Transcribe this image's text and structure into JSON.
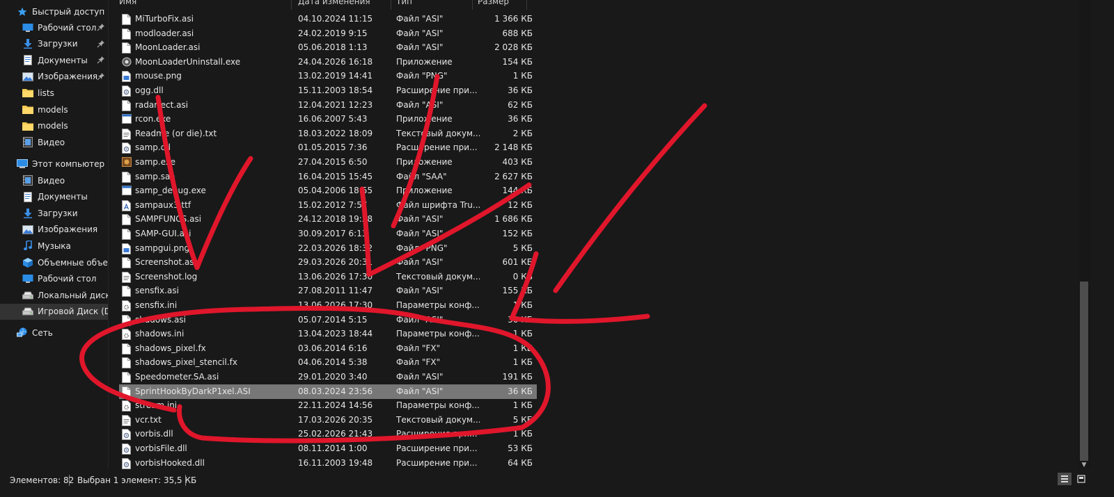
{
  "sidebar": {
    "quick_access": {
      "label": "Быстрый доступ",
      "icon": "star-icon"
    },
    "quick_items": [
      {
        "label": "Рабочий стол",
        "icon": "desktop-icon",
        "pinned": true
      },
      {
        "label": "Загрузки",
        "icon": "download-icon",
        "pinned": true
      },
      {
        "label": "Документы",
        "icon": "documents-icon",
        "pinned": true
      },
      {
        "label": "Изображения",
        "icon": "pictures-icon",
        "pinned": true
      },
      {
        "label": "lists",
        "icon": "folder-icon",
        "pinned": false
      },
      {
        "label": "models",
        "icon": "folder-icon",
        "pinned": false
      },
      {
        "label": "models",
        "icon": "folder-icon",
        "pinned": false
      },
      {
        "label": "Видео",
        "icon": "video-icon",
        "pinned": false
      }
    ],
    "this_pc": {
      "label": "Этот компьютер",
      "icon": "computer-icon"
    },
    "pc_items": [
      {
        "label": "Видео",
        "icon": "video-icon"
      },
      {
        "label": "Документы",
        "icon": "documents-icon"
      },
      {
        "label": "Загрузки",
        "icon": "download-icon"
      },
      {
        "label": "Изображения",
        "icon": "pictures-icon"
      },
      {
        "label": "Музыка",
        "icon": "music-icon"
      },
      {
        "label": "Объемные объекты",
        "icon": "3d-objects-icon"
      },
      {
        "label": "Рабочий стол",
        "icon": "desktop-icon"
      },
      {
        "label": "Локальный диск (C:)",
        "icon": "drive-icon"
      },
      {
        "label": "Игровой Диск (D:)",
        "icon": "drive-icon",
        "selected": true
      }
    ],
    "network": {
      "label": "Сеть",
      "icon": "network-icon"
    }
  },
  "columns": {
    "name": "Имя",
    "date": "Дата изменения",
    "type": "Тип",
    "size": "Размер"
  },
  "files": [
    {
      "name": "MiTurboFix.asi",
      "date": "04.10.2024 11:15",
      "type": "Файл \"ASI\"",
      "size": "1 366 КБ",
      "icon": "file-icon"
    },
    {
      "name": "modloader.asi",
      "date": "24.02.2019 9:15",
      "type": "Файл \"ASI\"",
      "size": "688 КБ",
      "icon": "file-icon"
    },
    {
      "name": "MoonLoader.asi",
      "date": "05.06.2018 1:13",
      "type": "Файл \"ASI\"",
      "size": "2 028 КБ",
      "icon": "file-icon"
    },
    {
      "name": "MoonLoaderUninstall.exe",
      "date": "24.04.2026 16:18",
      "type": "Приложение",
      "size": "154 КБ",
      "icon": "installer-icon"
    },
    {
      "name": "mouse.png",
      "date": "13.02.2019 14:41",
      "type": "Файл \"PNG\"",
      "size": "1 КБ",
      "icon": "image-file-icon"
    },
    {
      "name": "ogg.dll",
      "date": "15.11.2003 18:54",
      "type": "Расширение при...",
      "size": "36 КБ",
      "icon": "dll-icon"
    },
    {
      "name": "radarrect.asi",
      "date": "12.04.2021 12:23",
      "type": "Файл \"ASI\"",
      "size": "62 КБ",
      "icon": "file-icon"
    },
    {
      "name": "rcon.exe",
      "date": "16.06.2007 5:43",
      "type": "Приложение",
      "size": "36 КБ",
      "icon": "exe-icon"
    },
    {
      "name": "Readme (or die).txt",
      "date": "18.03.2022 18:09",
      "type": "Текстовый докум...",
      "size": "2 КБ",
      "icon": "text-file-icon"
    },
    {
      "name": "samp.dll",
      "date": "01.05.2015 7:36",
      "type": "Расширение при...",
      "size": "2 148 КБ",
      "icon": "dll-icon"
    },
    {
      "name": "samp.exe",
      "date": "27.04.2015 6:50",
      "type": "Приложение",
      "size": "403 КБ",
      "icon": "samp-app-icon"
    },
    {
      "name": "samp.saa",
      "date": "16.04.2015 15:45",
      "type": "Файл \"SAA\"",
      "size": "2 627 КБ",
      "icon": "file-icon"
    },
    {
      "name": "samp_debug.exe",
      "date": "05.04.2006 18:55",
      "type": "Приложение",
      "size": "144 КБ",
      "icon": "exe-icon"
    },
    {
      "name": "sampaux3.ttf",
      "date": "15.02.2012 7:57",
      "type": "Файл шрифта Tru...",
      "size": "12 КБ",
      "icon": "font-file-icon"
    },
    {
      "name": "SAMPFUNCS.asi",
      "date": "24.12.2018 19:28",
      "type": "Файл \"ASI\"",
      "size": "1 686 КБ",
      "icon": "file-icon"
    },
    {
      "name": "SAMP-GUI.asi",
      "date": "30.09.2017 6:13",
      "type": "Файл \"ASI\"",
      "size": "152 КБ",
      "icon": "file-icon"
    },
    {
      "name": "sampgui.png",
      "date": "22.03.2026 18:32",
      "type": "Файл \"PNG\"",
      "size": "5 КБ",
      "icon": "image-file-icon"
    },
    {
      "name": "Screenshot.asi",
      "date": "29.03.2026 20:31",
      "type": "Файл \"ASI\"",
      "size": "601 КБ",
      "icon": "file-icon"
    },
    {
      "name": "Screenshot.log",
      "date": "13.06.2026 17:30",
      "type": "Текстовый докум...",
      "size": "0 КБ",
      "icon": "text-file-icon"
    },
    {
      "name": "sensfix.asi",
      "date": "27.08.2011 11:47",
      "type": "Файл \"ASI\"",
      "size": "155 КБ",
      "icon": "file-icon"
    },
    {
      "name": "sensfix.ini",
      "date": "13.06.2026 17:30",
      "type": "Параметры конф...",
      "size": "1 КБ",
      "icon": "settings-file-icon"
    },
    {
      "name": "shadows.asi",
      "date": "05.07.2014 5:15",
      "type": "Файл \"ASI\"",
      "size": "36 КБ",
      "icon": "file-icon"
    },
    {
      "name": "shadows.ini",
      "date": "13.04.2023 18:44",
      "type": "Параметры конф...",
      "size": "1 КБ",
      "icon": "settings-file-icon"
    },
    {
      "name": "shadows_pixel.fx",
      "date": "03.06.2014 6:16",
      "type": "Файл \"FX\"",
      "size": "1 КБ",
      "icon": "file-icon"
    },
    {
      "name": "shadows_pixel_stencil.fx",
      "date": "04.06.2014 5:38",
      "type": "Файл \"FX\"",
      "size": "1 КБ",
      "icon": "file-icon"
    },
    {
      "name": "Speedometer.SA.asi",
      "date": "29.01.2020 3:40",
      "type": "Файл \"ASI\"",
      "size": "191 КБ",
      "icon": "file-icon"
    },
    {
      "name": "SprintHookByDarkP1xel.ASI",
      "date": "08.03.2024 23:56",
      "type": "Файл \"ASI\"",
      "size": "36 КБ",
      "icon": "file-icon",
      "selected": true
    },
    {
      "name": "stream.ini",
      "date": "22.11.2024 14:56",
      "type": "Параметры конф...",
      "size": "1 КБ",
      "icon": "settings-file-icon"
    },
    {
      "name": "vcr.txt",
      "date": "17.03.2026 20:35",
      "type": "Текстовый докум...",
      "size": "5 КБ",
      "icon": "text-file-icon"
    },
    {
      "name": "vorbis.dll",
      "date": "25.02.2026 21:43",
      "type": "Расширение при...",
      "size": "1 КБ",
      "icon": "dll-icon"
    },
    {
      "name": "vorbisFile.dll",
      "date": "08.11.2014 1:00",
      "type": "Расширение при...",
      "size": "53 КБ",
      "icon": "dll-icon"
    },
    {
      "name": "vorbisHooked.dll",
      "date": "16.11.2003 19:48",
      "type": "Расширение при...",
      "size": "64 КБ",
      "icon": "dll-icon"
    }
  ],
  "status": {
    "items_count": "Элементов: 82",
    "selection": "Выбран 1 элемент: 35,5 КБ"
  },
  "view_buttons": {
    "details": "details-view-icon",
    "tiles": "large-icons-view-icon"
  },
  "annotation": {
    "color": "#e0162b"
  },
  "colors": {
    "background": "#191919",
    "selected_row": "#777777",
    "text": "#e6e6e6"
  }
}
